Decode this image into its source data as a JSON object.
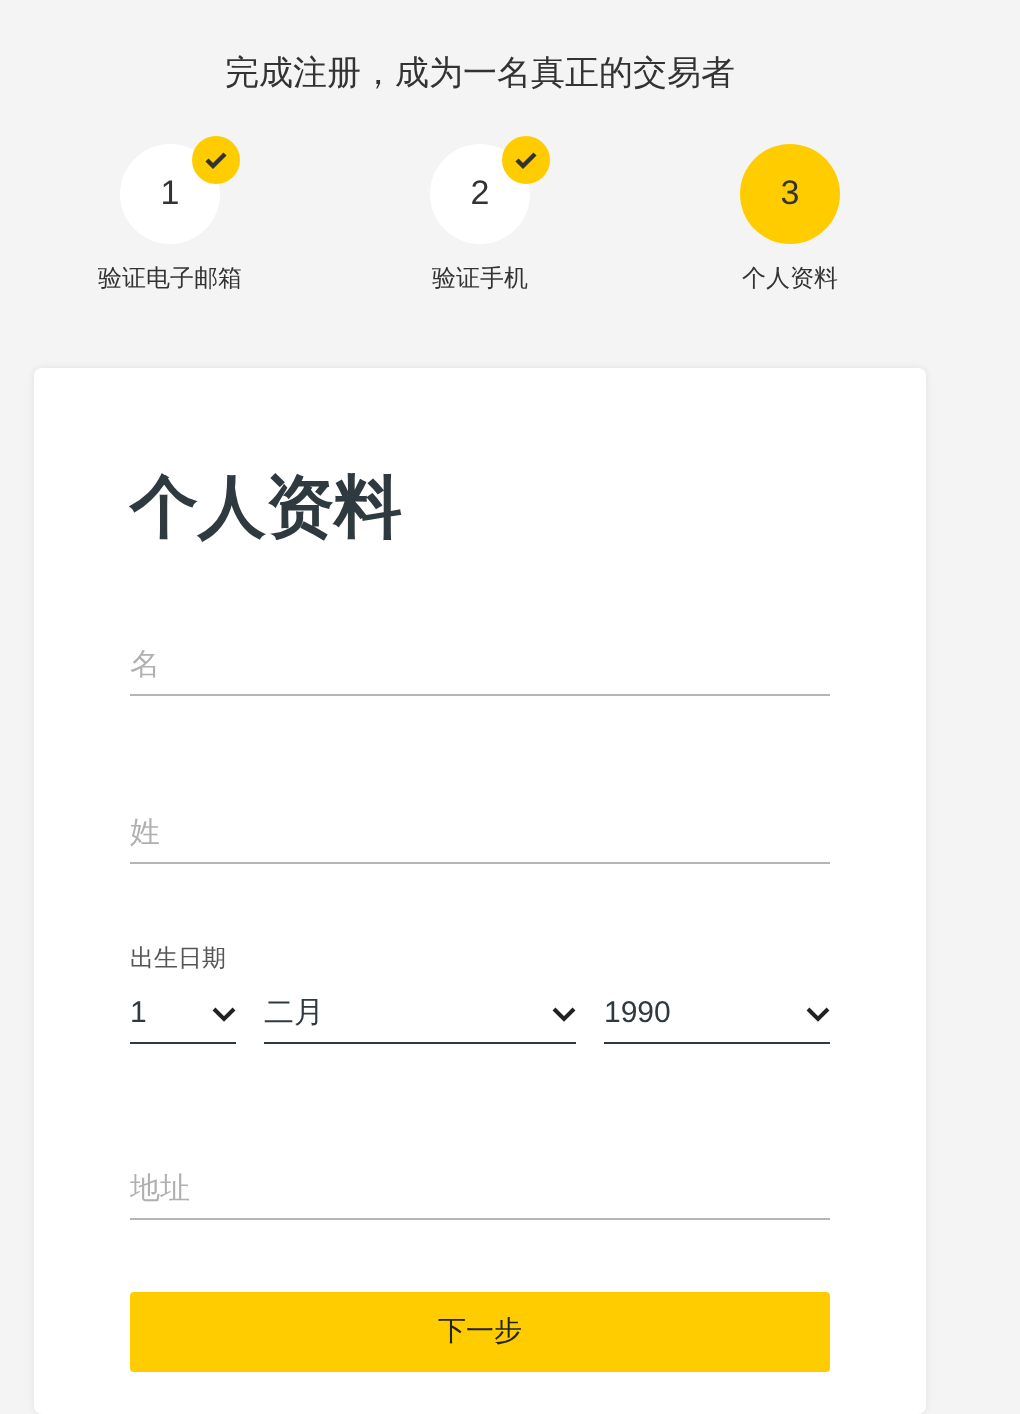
{
  "heading": "完成注册，成为一名真正的交易者",
  "steps": [
    {
      "number": "1",
      "label": "验证电子邮箱",
      "completed": true,
      "selected": false
    },
    {
      "number": "2",
      "label": "验证手机",
      "completed": true,
      "selected": false
    },
    {
      "number": "3",
      "label": "个人资料",
      "completed": false,
      "selected": true
    }
  ],
  "form": {
    "title": "个人资料",
    "first_name": {
      "placeholder": "名"
    },
    "last_name": {
      "placeholder": "姓"
    },
    "birth_date": {
      "label": "出生日期",
      "day": "1",
      "month": "二月",
      "year": "1990"
    },
    "address": {
      "placeholder": "地址"
    },
    "submit": "下一步"
  }
}
